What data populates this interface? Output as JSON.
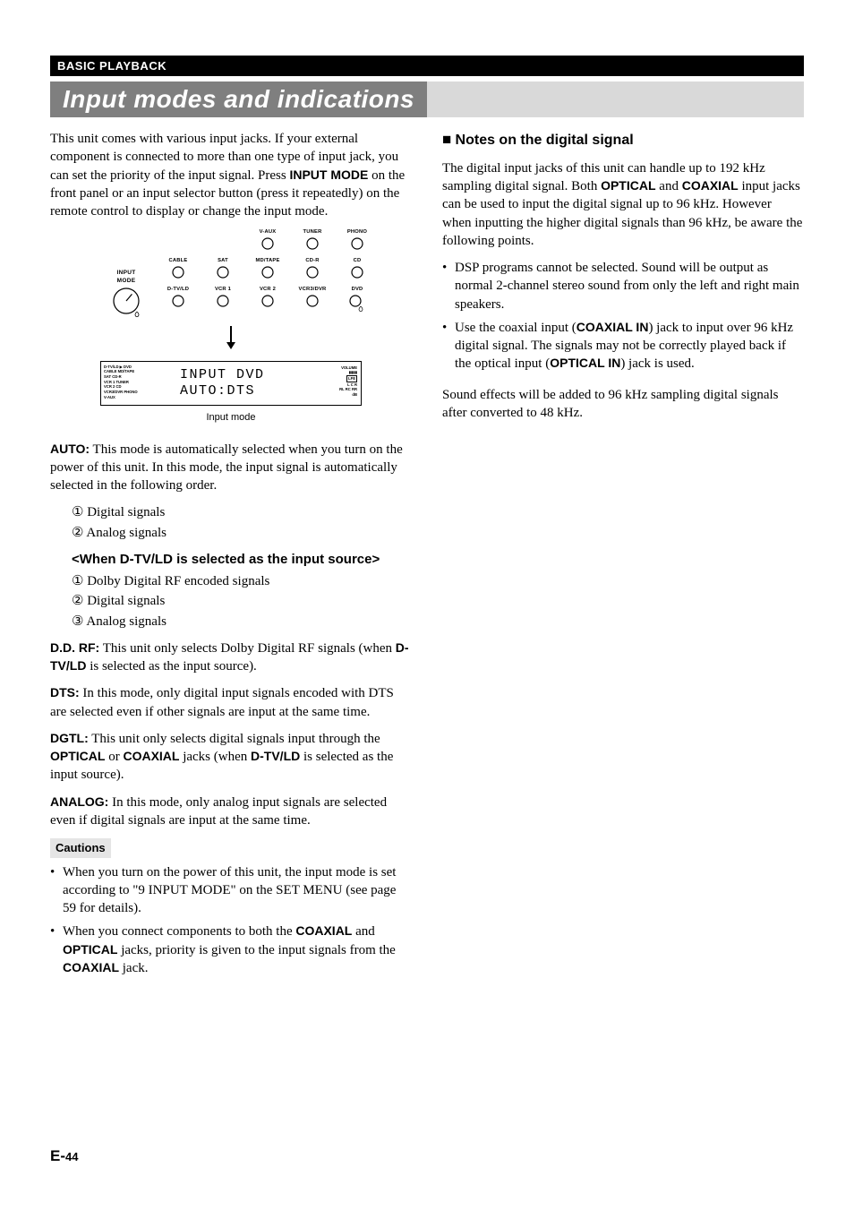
{
  "header": {
    "breadcrumb": "BASIC PLAYBACK"
  },
  "section_title": "Input modes and indications",
  "left": {
    "intro": {
      "pre": "This unit comes with various input jacks. If your external component is connected to more than one type of input jack, you can set the priority of the input signal. Press ",
      "bold1": "INPUT MODE",
      "post": " on the front panel or an input selector button (press it repeatedly) on the remote control to display or change the input mode."
    },
    "diagram": {
      "dial_label": "INPUT MODE",
      "row1": [
        "V-AUX",
        "TUNER",
        "PHONO"
      ],
      "row2": [
        "CABLE",
        "SAT",
        "MD/TAPE",
        "CD-R",
        "CD"
      ],
      "row3": [
        "D-TV/LD",
        "VCR 1",
        "VCR 2",
        "VCR3/DVR",
        "DVD"
      ],
      "lcd_left": [
        "D-TV/LD  ▶  DVD",
        "CABLE     MD/TAPE",
        "SAT         CD-R",
        "VCR 1     TUNER",
        "VCR 2       CD",
        "VCR3/DVR  PHONO",
        "V-AUX"
      ],
      "lcd_center_line1": "INPUT    DVD",
      "lcd_center_line2": "AUTO:DTS",
      "lcd_right_vol": "VOLUME",
      "lcd_right_db": "dB",
      "lcd_caption": "Input mode"
    },
    "auto": {
      "label": "AUTO:",
      "text": " This mode is automatically selected when you turn on the power of this unit. In this mode, the input signal is automatically selected in the following order.",
      "items": [
        "Digital signals",
        "Analog signals"
      ]
    },
    "when": {
      "heading": "<When D-TV/LD is selected as the input source>",
      "items": [
        "Dolby Digital RF encoded signals",
        "Digital signals",
        "Analog signals"
      ]
    },
    "ddrf": {
      "label": "D.D. RF:",
      "pre": " This unit only selects Dolby Digital RF signals (when ",
      "bold": "D-TV/LD",
      "post": " is selected as the input source)."
    },
    "dts": {
      "label": "DTS:",
      "text": " In this mode, only digital input signals encoded with DTS are selected even if other signals are input at the same time."
    },
    "dgtl": {
      "label": "DGTL:",
      "pre": " This unit only selects digital signals input through the ",
      "b1": "OPTICAL",
      "mid1": " or ",
      "b2": "COAXIAL",
      "mid2": " jacks (when ",
      "b3": "D-TV/LD",
      "post": " is selected as the input source)."
    },
    "analog": {
      "label": "ANALOG:",
      "text": " In this mode, only analog input signals are selected even if digital signals are input at the same time."
    },
    "cautions": {
      "label": "Cautions",
      "items": [
        {
          "pre": "When you turn on the power of this unit, the input mode is set according to \"9 INPUT MODE\" on the SET MENU (see page 59 for details)."
        },
        {
          "pre": "When you connect components to both the ",
          "b1": "COAXIAL",
          "mid1": " and ",
          "b2": "OPTICAL",
          "mid2": " jacks, priority is given to the input signals from the ",
          "b3": "COAXIAL",
          "post": " jack."
        }
      ]
    }
  },
  "right": {
    "heading": {
      "sq": "■ ",
      "text": "Notes on the digital signal"
    },
    "p1": {
      "pre": "The digital input jacks of this unit can handle up to 192 kHz sampling digital signal. Both ",
      "b1": "OPTICAL",
      "mid1": " and ",
      "b2": "COAXIAL",
      "post": " input jacks can be used to input the digital signal up to 96 kHz. However when inputting the higher digital signals than 96 kHz, be aware the following points."
    },
    "bullets": [
      {
        "text": "DSP programs cannot be selected. Sound will be output as normal 2-channel stereo sound from only the left and right main speakers."
      },
      {
        "pre": "Use the coaxial input (",
        "b1": "COAXIAL IN",
        "mid1": ") jack to input over 96 kHz digital signal. The signals may not be correctly played back if the optical input (",
        "b2": "OPTICAL IN",
        "post": ") jack is used."
      }
    ],
    "p2": "Sound effects will be added to 96 kHz sampling digital signals after converted to 48 kHz."
  },
  "page_num": {
    "prefix": "E-",
    "num": "44"
  },
  "circled": [
    "①",
    "②",
    "③"
  ]
}
